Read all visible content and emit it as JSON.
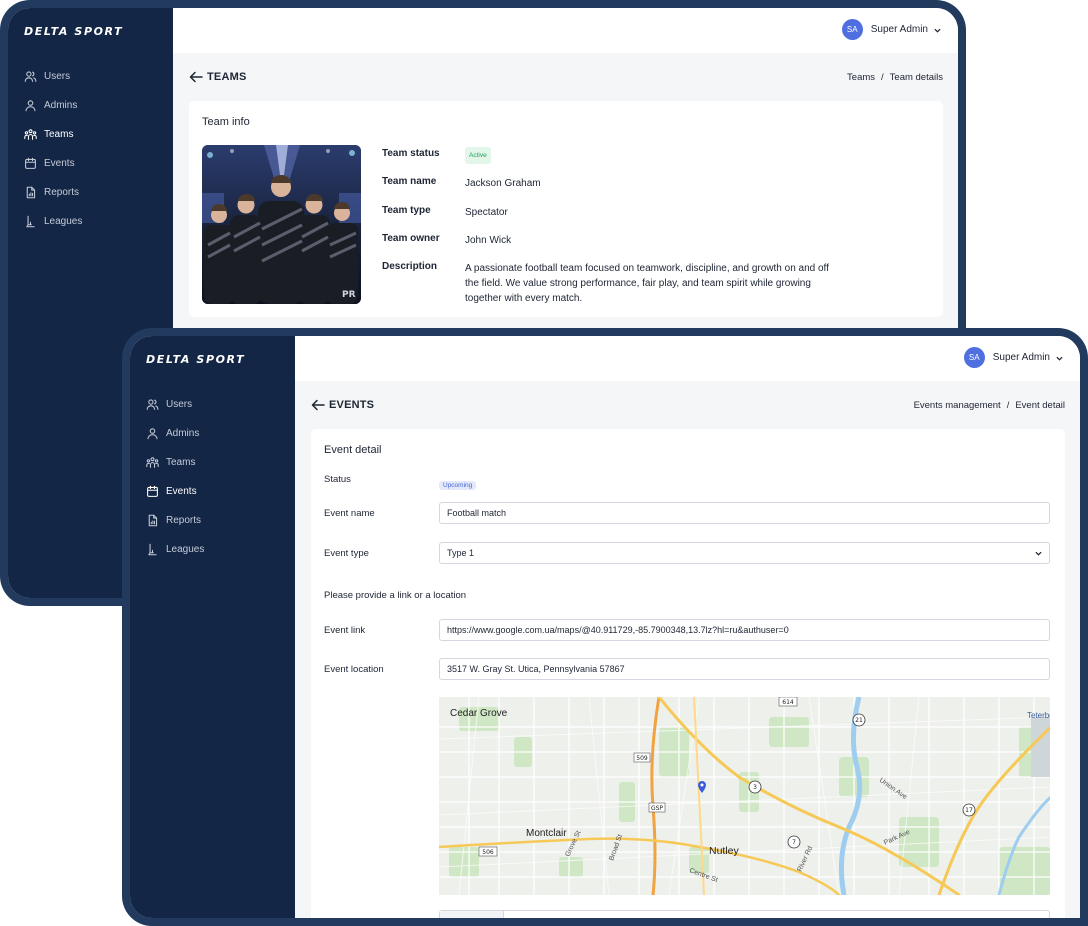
{
  "brand": {
    "logo": "DELTA SPORT"
  },
  "nav": [
    {
      "label": "Users",
      "icon": "users-icon"
    },
    {
      "label": "Admins",
      "icon": "admin-icon"
    },
    {
      "label": "Teams",
      "icon": "teams-icon"
    },
    {
      "label": "Events",
      "icon": "calendar-icon"
    },
    {
      "label": "Reports",
      "icon": "report-icon"
    },
    {
      "label": "Leagues",
      "icon": "league-icon"
    }
  ],
  "user": {
    "initials": "SA",
    "name": "Super Admin"
  },
  "team_screen": {
    "heading": "TEAMS",
    "breadcrumb": [
      "Teams",
      "Team details"
    ],
    "card_title": "Team info",
    "fields": {
      "status_label": "Team status",
      "status_value": "Active",
      "name_label": "Team name",
      "name_value": "Jackson Graham",
      "type_label": "Team type",
      "type_value": "Spectator",
      "owner_label": "Team owner",
      "owner_value": "John Wick",
      "description_label": "Description",
      "description_value": "A passionate football team focused on teamwork, discipline, and growth on and off the field. We value strong performance, fair play, and team spirit while growing together with every match."
    }
  },
  "event_screen": {
    "heading": "EVENTS",
    "breadcrumb": [
      "Events management",
      "Event detail"
    ],
    "card_title": "Event detail",
    "status_label": "Status",
    "status_value": "Upcoming",
    "name_label": "Event name",
    "name_value": "Football match",
    "type_label": "Event type",
    "type_value": "Type 1",
    "hint": "Please provide a link or a location",
    "link_label": "Event link",
    "link_value": "https://www.google.com.ua/maps/@40.911729,-85.7900348,13.7lz?hl=ru&authuser=0",
    "location_label": "Event location",
    "location_value": "3517 W. Gray St. Utica, Pennsylvania 57867",
    "map": {
      "places": [
        "Cedar Grove",
        "Montclair",
        "Nutley",
        "Teterbo"
      ],
      "streets": [
        "Grove St",
        "Broad St",
        "Centre St",
        "River Rd",
        "Park Ave",
        "Union Ave"
      ],
      "shields": [
        "614",
        "509",
        "GSP",
        "506",
        "21",
        "3",
        "7",
        "17"
      ]
    }
  },
  "colors": {
    "sidebar": "#142645",
    "frame": "#223a5e",
    "accent": "#4f6fe0",
    "active_badge": "#22a05b",
    "upcoming_badge": "#4a64d8"
  }
}
